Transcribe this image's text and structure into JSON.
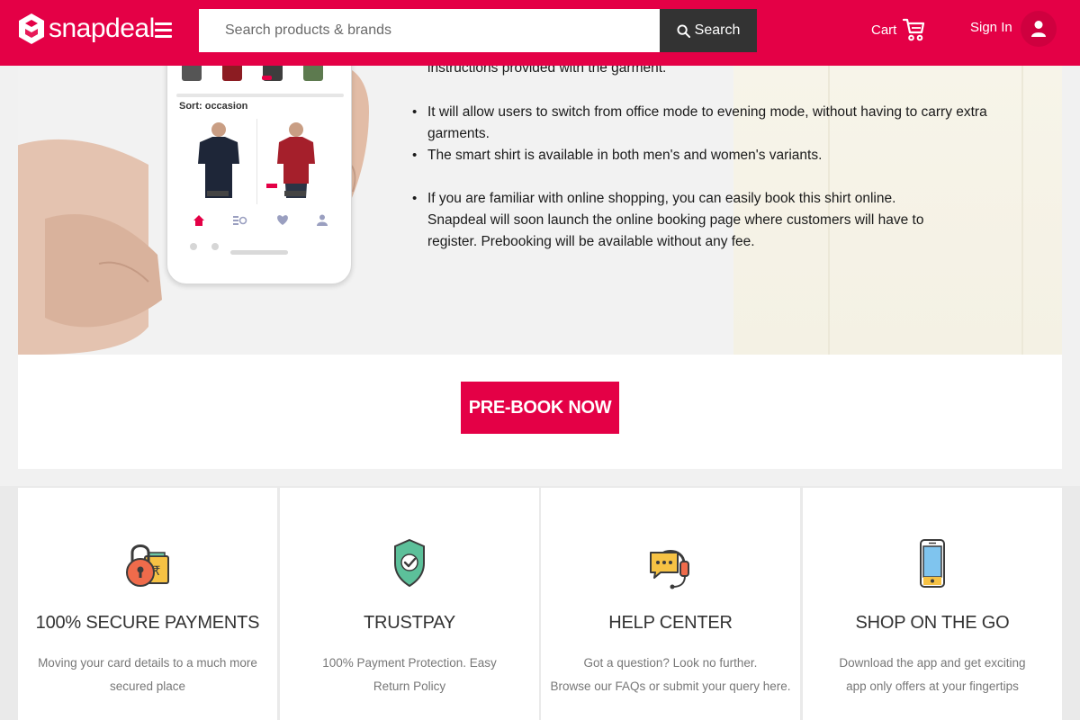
{
  "header": {
    "logo_text": "snapdeal",
    "search_placeholder": "Search products & brands",
    "search_button": "Search",
    "cart_label": "Cart",
    "signin_label": "Sign In",
    "brand_color": "#e40046"
  },
  "hero": {
    "phone": {
      "sort_label": "Sort: occasion"
    },
    "continued_text": "instructions provided with the garment.",
    "bullets": [
      {
        "text": "It will allow users to switch from office mode to evening mode, without having to carry extra garments."
      },
      {
        "text": "The smart shirt is available in both men's and women's variants."
      },
      {
        "text": "If you are familiar with online shopping, you can easily book this shirt online. Snapdeal will soon launch the online booking page where customers will have to register. Prebooking will be available without any fee."
      }
    ]
  },
  "cta": {
    "label": "PRE-BOOK NOW"
  },
  "features": [
    {
      "icon": "lock-payment-icon",
      "title": "100% SECURE PAYMENTS",
      "desc_line1": "Moving your card details to a much more",
      "desc_line2": "secured place"
    },
    {
      "icon": "shield-check-icon",
      "title": "TRUSTPAY",
      "desc_line1": "100% Payment Protection. Easy",
      "desc_line2": "Return Policy"
    },
    {
      "icon": "headset-chat-icon",
      "title": "HELP CENTER",
      "desc_line1": "Got a question? Look no further.",
      "desc_line2": "Browse our FAQs or submit your query here."
    },
    {
      "icon": "smartphone-icon",
      "title": "SHOP ON THE GO",
      "desc_line1": "Download the app and get exciting",
      "desc_line2": "app only offers at your fingertips"
    }
  ]
}
